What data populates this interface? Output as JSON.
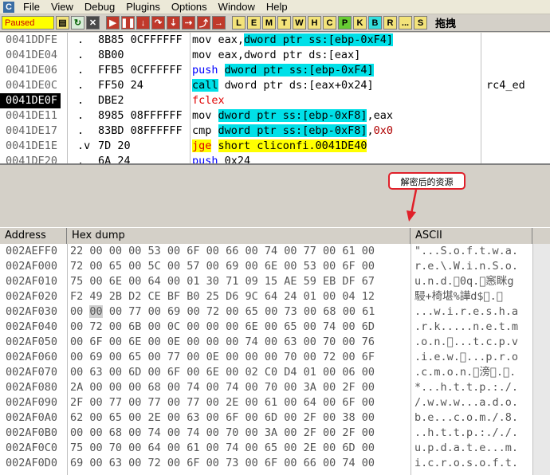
{
  "app": {
    "icon": "C",
    "menu": [
      "File",
      "View",
      "Debug",
      "Plugins",
      "Options",
      "Window",
      "Help"
    ]
  },
  "toolbar": {
    "status": "Paused",
    "buttons": [
      {
        "icon": "open-icon",
        "glyph": "▤",
        "style": "yellow"
      },
      {
        "icon": "restart-icon",
        "glyph": "↻",
        "style": "green"
      },
      {
        "icon": "close-icon",
        "glyph": "✕",
        "style": "dark"
      },
      {
        "icon": "run-icon",
        "glyph": "▶",
        "style": "red"
      },
      {
        "icon": "pause-icon",
        "glyph": "❚❚",
        "style": "red"
      },
      {
        "icon": "step-into-icon",
        "glyph": "↓",
        "style": "red"
      },
      {
        "icon": "step-over-icon",
        "glyph": "↷",
        "style": "red"
      },
      {
        "icon": "trace-into-icon",
        "glyph": "⇣",
        "style": "red"
      },
      {
        "icon": "trace-over-icon",
        "glyph": "⇢",
        "style": "red"
      },
      {
        "icon": "execute-till-return-icon",
        "glyph": "⤴",
        "style": "red"
      },
      {
        "icon": "go-to-icon",
        "glyph": "→",
        "style": "red"
      }
    ],
    "letters": [
      "L",
      "E",
      "M",
      "T",
      "W",
      "H",
      "C",
      "P",
      "K",
      "B",
      "R",
      "...",
      "S"
    ],
    "letter_highlight": {
      "P": "hl",
      "B": "cyan"
    },
    "extra_label": "拖拽"
  },
  "disasm": {
    "rows": [
      {
        "addr": "0041DDFE",
        "mark": ".",
        "bytes": "8B85 0CFFFFFF",
        "parts": [
          {
            "t": "mov eax,"
          },
          {
            "t": "dword ptr ss:[ebp-0xF4]",
            "c": "hl-cyan"
          }
        ],
        "comment": ""
      },
      {
        "addr": "0041DE04",
        "mark": ".",
        "bytes": "8B00",
        "parts": [
          {
            "t": "mov eax,dword ptr ds:[eax]"
          }
        ],
        "comment": ""
      },
      {
        "addr": "0041DE06",
        "mark": ".",
        "bytes": "FFB5 0CFFFFFF",
        "parts": [
          {
            "t": "push",
            "c": "kw-blue"
          },
          {
            "t": " "
          },
          {
            "t": "dword ptr ss:[ebp-0xF4]",
            "c": "hl-cyan"
          }
        ],
        "comment": ""
      },
      {
        "addr": "0041DE0C",
        "mark": ".",
        "bytes": "FF50 24",
        "parts": [
          {
            "t": "call",
            "c": "hl-cyan"
          },
          {
            "t": " dword ptr ds:[eax+0x24]"
          }
        ],
        "comment": "rc4_ed"
      },
      {
        "addr": "0041DE0F",
        "mark": ".",
        "bytes": "DBE2",
        "parts": [
          {
            "t": "fclex",
            "c": "kw-red"
          }
        ],
        "comment": "",
        "selected": true
      },
      {
        "addr": "0041DE11",
        "mark": ".",
        "bytes": "8985 08FFFFFF",
        "parts": [
          {
            "t": "mov "
          },
          {
            "t": "dword ptr ss:[ebp-0xF8]",
            "c": "hl-cyan"
          },
          {
            "t": ",eax"
          }
        ],
        "comment": ""
      },
      {
        "addr": "0041DE17",
        "mark": ".",
        "bytes": "83BD 08FFFFFF",
        "parts": [
          {
            "t": "cmp "
          },
          {
            "t": "dword ptr ss:[ebp-0xF8]",
            "c": "hl-cyan"
          },
          {
            "t": ","
          },
          {
            "t": "0x0",
            "c": "num-red"
          }
        ],
        "comment": ""
      },
      {
        "addr": "0041DE1E",
        "mark": ".v",
        "bytes": "7D 20",
        "parts": [
          {
            "t": "jge",
            "c": "hl-yellow kw-red"
          },
          {
            "t": " "
          },
          {
            "t": "short cliconfi.0041DE40",
            "c": "hl-yellow"
          }
        ],
        "comment": ""
      },
      {
        "addr": "0041DE20",
        "mark": ".",
        "bytes": "6A 24",
        "parts": [
          {
            "t": "push",
            "c": "kw-blue"
          },
          {
            "t": " 0x24"
          }
        ],
        "comment": ""
      }
    ]
  },
  "annotation": {
    "callout_text": "解密后的资源"
  },
  "dump": {
    "headers": [
      "Address",
      "Hex dump",
      "ASCII"
    ],
    "rows": [
      {
        "addr": "002AEFF0",
        "hex": "22 00 00 00 53 00 6F 00 66 00 74 00 77 00 61 00",
        "ascii": "\"...S.o.f.t.w.a."
      },
      {
        "addr": "002AF000",
        "hex": "72 00 65 00 5C 00 57 00 69 00 6E 00 53 00 6F 00",
        "ascii": "r.e.\\.W.i.n.S.o."
      },
      {
        "addr": "002AF010",
        "hex": "75 00 6E 00 64 00 01 30 71 09 15 AE 59 EB DF 67",
        "ascii": "u.n.d.\u00000q.\u0000窸眯g"
      },
      {
        "addr": "002AF020",
        "hex": "F2 49 2B D2 CE BF B0 25 D6 9C 64 24 01 00 04 12",
        "ascii": "駸+椅堪%譁d$\u0000.\u0000"
      },
      {
        "addr": "002AF030",
        "hex": "00 00 00 77 00 69 00 72 00 65 00 73 00 68 00 61",
        "ascii": "...w.i.r.e.s.h.a"
      },
      {
        "addr": "002AF040",
        "hex": "00 72 00 6B 00 0C 00 00 00 6E 00 65 00 74 00 6D",
        "ascii": ".r.k.....n.e.t.m"
      },
      {
        "addr": "002AF050",
        "hex": "00 6F 00 6E 00 0E 00 00 00 74 00 63 00 70 00 76",
        "ascii": ".o.n.\u0000...t.c.p.v"
      },
      {
        "addr": "002AF060",
        "hex": "00 69 00 65 00 77 00 0E 00 00 00 70 00 72 00 6F",
        "ascii": ".i.e.w.\u0000...p.r.o"
      },
      {
        "addr": "002AF070",
        "hex": "00 63 00 6D 00 6F 00 6E 00 02 C0 D4 01 00 06 00",
        "ascii": ".c.m.o.n.\u0000滂\u0000.\u0000."
      },
      {
        "addr": "002AF080",
        "hex": "2A 00 00 00 68 00 74 00 74 00 70 00 3A 00 2F 00",
        "ascii": "*...h.t.t.p.:./."
      },
      {
        "addr": "002AF090",
        "hex": "2F 00 77 00 77 00 77 00 2E 00 61 00 64 00 6F 00",
        "ascii": "/.w.w.w...a.d.o."
      },
      {
        "addr": "002AF0A0",
        "hex": "62 00 65 00 2E 00 63 00 6F 00 6D 00 2F 00 38 00",
        "ascii": "b.e...c.o.m./.8."
      },
      {
        "addr": "002AF0B0",
        "hex": "00 00 68 00 74 00 74 00 70 00 3A 00 2F 00 2F 00",
        "ascii": "..h.t.t.p.:././."
      },
      {
        "addr": "002AF0C0",
        "hex": "75 00 70 00 64 00 61 00 74 00 65 00 2E 00 6D 00",
        "ascii": "u.p.d.a.t.e...m."
      },
      {
        "addr": "002AF0D0",
        "hex": "69 00 63 00 72 00 6F 00 73 00 6F 00 66 00 74 00",
        "ascii": "i.c.r.o.s.o.f.t."
      }
    ],
    "selected_row": 4,
    "selected_byte": 1
  }
}
